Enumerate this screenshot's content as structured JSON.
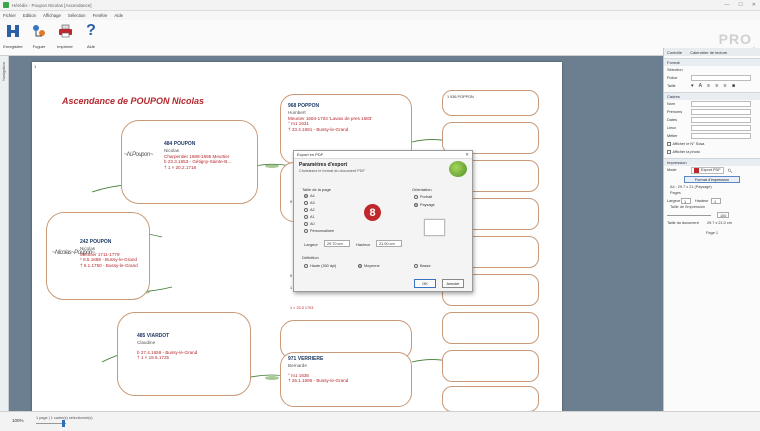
{
  "window": {
    "title": "Hérédis - Poupon Nicolas [Ascendance]",
    "controls": [
      "—",
      "☐",
      "✕"
    ]
  },
  "menu": [
    "Fichier",
    "Edition",
    "Affichage",
    "Sélection",
    "Fenêtre",
    "Aide"
  ],
  "toolbar": [
    {
      "label": "Enregistrer",
      "icon": "save-icon"
    },
    {
      "label": "Fuguer",
      "icon": "tree-icon"
    },
    {
      "label": "Imprimer",
      "icon": "print-icon"
    },
    {
      "label": "Aide",
      "icon": "help-icon"
    }
  ],
  "brand": "PRO",
  "side_tab": "Navigation",
  "document": {
    "page_number": "1",
    "title": "Ascendance de POUPON Nicolas",
    "persons": {
      "p1": {
        "name": "484 POUPON",
        "given": "Nicolas",
        "l1": "Charpentier 1689-1695 Meurtier",
        "l2": "b 23.3.1653 - Gétigny-Sainte-B...",
        "l3": "† 1 × 20.2.1718"
      },
      "p2": {
        "name": "242 POUPON",
        "given": "Nicolas",
        "l1": "Meunier 1711-1779",
        "l2": "* 8.5.1688 - Bussy-le-Grand",
        "l3": "† 6.1.1750 - Bussy-le-Grand"
      },
      "p3": {
        "name": "485 VIARDOT",
        "given": "Claudine",
        "l1": "b 27.4.1659 - Bussy-le-Grand",
        "l2": "† 1 × 19.6.1725"
      },
      "p4": {
        "name": "968 POPPON",
        "given": "Humbert",
        "l1": "Meunier 1684-1704 'Lavaix de pres 1683'",
        "l2": "° m1 1631",
        "l3": "† 23.4.1691 - Bussy-le-Grand"
      },
      "p5": {
        "name": "971 VERRIERE",
        "given": "Bernarde",
        "l1": "° m1 1636",
        "l2": "† 26.1.1695 - Bussy-le-Grand"
      }
    },
    "right_labels": {
      "top": "1 936 POPPON",
      "mid": "1 × 23.5 1703",
      "mid_num_1": "9",
      "mid_num_2": "9",
      "mid_num_3": "1"
    }
  },
  "dialog": {
    "window_title": "Export en PDF",
    "heading": "Paramètres d'export",
    "subheading": "Choisissez le format du document PDF",
    "format_label": "Taille de la page",
    "formats": [
      "A4",
      "A3",
      "A2",
      "A1",
      "A0",
      "Personnalisée"
    ],
    "selected_format": "A4",
    "orientation_label": "Orientation",
    "orientations": [
      "Portrait",
      "Paysage"
    ],
    "selected_orientation": "Paysage",
    "width_label": "Largeur",
    "width_value": "29.70 cm",
    "height_label": "Hauteur",
    "height_value": "21.00 cm",
    "definition_label": "Définition",
    "definitions": [
      "Haute (300 dpi)",
      "Moyenne",
      "Basse"
    ],
    "selected_definition": "Moyenne",
    "ok": "OK",
    "cancel": "Annuler"
  },
  "step_badge": "8",
  "panel": {
    "tabs": [
      "Contrôle",
      "Calendrier de lecture"
    ],
    "section_format": "Format",
    "tab_selection": "Sélection",
    "police_label": "Police",
    "taille_label": "Taille",
    "section_cadres": "Cadres",
    "rows": [
      "Nom",
      "Prénoms",
      "Dates",
      "Lieux",
      "Métier"
    ],
    "check1": "Afficher le N° Sosa",
    "check2": "Afficher la photo",
    "section_impression": "Impression",
    "mode_label": "Mode",
    "mode_value": "Export PDF",
    "format_btn": "Format d'impression",
    "format_info": "A4 : 29.7 x 21 (Paysage)",
    "pages_label": "Pages",
    "largeur_label": "Largeur",
    "largeur_val": "1",
    "hauteur_label": "Hauteur",
    "hauteur_val": "1",
    "taille_impr_label": "Taille de l'impression",
    "taille_impr_val": "100",
    "taille_doc_label": "Taille du document",
    "taille_doc_val": "29.7 x 21.0 cm",
    "page_label": "Page 1"
  },
  "status": {
    "zoom": "100%",
    "page_text": "1 page  |  1 cadre(s) sélectionné(s)"
  }
}
